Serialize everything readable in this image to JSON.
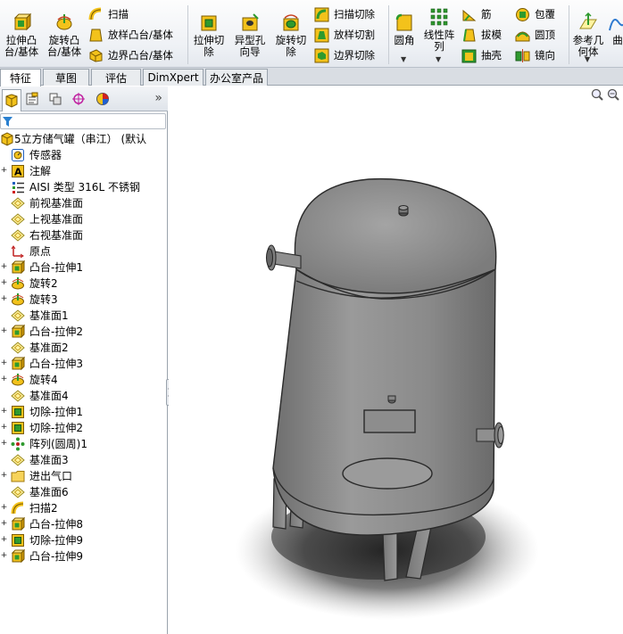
{
  "ribbon": {
    "extrude_boss": "拉伸凸\n台/基体",
    "revolve_boss": "旋转凸\n台/基体",
    "sweep": "扫描",
    "loft_boss": "放样凸台/基体",
    "boundary_boss": "边界凸台/基体",
    "extrude_cut": "拉伸切\n除",
    "hole_wizard": "异型孔\n向导",
    "revolve_cut": "旋转切\n除",
    "sweep_cut": "扫描切除",
    "loft_cut": "放样切割",
    "boundary_cut": "边界切除",
    "fillet": "圆角",
    "linear_pattern": "线性阵\n列",
    "rib": "筋",
    "draft": "拔模",
    "shell": "抽壳",
    "wrap": "包覆",
    "dome": "圆顶",
    "mirror": "镜向",
    "ref_geometry": "参考几\n何体",
    "curves": "曲"
  },
  "tabs": [
    {
      "label": "特征",
      "active": true
    },
    {
      "label": "草图",
      "active": false
    },
    {
      "label": "评估",
      "active": false
    },
    {
      "label": "DimXpert",
      "active": false
    },
    {
      "label": "办公室产品",
      "active": false
    }
  ],
  "panel": {
    "more": "»",
    "tree": [
      {
        "label": "5立方储气罐（串江）  (默认",
        "icon": "part-icon",
        "expand": ""
      },
      {
        "label": "传感器",
        "icon": "sensor-icon",
        "expand": ""
      },
      {
        "label": "注解",
        "icon": "annotation-icon",
        "expand": "+"
      },
      {
        "label": "AISI 类型 316L 不锈钢",
        "icon": "material-icon",
        "expand": ""
      },
      {
        "label": "前视基准面",
        "icon": "plane-icon",
        "expand": ""
      },
      {
        "label": "上视基准面",
        "icon": "plane-icon",
        "expand": ""
      },
      {
        "label": "右视基准面",
        "icon": "plane-icon",
        "expand": ""
      },
      {
        "label": "原点",
        "icon": "origin-icon",
        "expand": ""
      },
      {
        "label": "凸台-拉伸1",
        "icon": "extrude-icon",
        "expand": "+"
      },
      {
        "label": "旋转2",
        "icon": "revolve-icon",
        "expand": "+"
      },
      {
        "label": "旋转3",
        "icon": "revolve-icon",
        "expand": "+"
      },
      {
        "label": "基准面1",
        "icon": "plane-icon",
        "expand": ""
      },
      {
        "label": "凸台-拉伸2",
        "icon": "extrude-icon",
        "expand": "+"
      },
      {
        "label": "基准面2",
        "icon": "plane-icon",
        "expand": ""
      },
      {
        "label": "凸台-拉伸3",
        "icon": "extrude-icon",
        "expand": "+"
      },
      {
        "label": "旋转4",
        "icon": "revolve-icon",
        "expand": "+"
      },
      {
        "label": "基准面4",
        "icon": "plane-icon",
        "expand": ""
      },
      {
        "label": "切除-拉伸1",
        "icon": "cut-icon",
        "expand": "+"
      },
      {
        "label": "切除-拉伸2",
        "icon": "cut-icon",
        "expand": "+"
      },
      {
        "label": "阵列(圆周)1",
        "icon": "pattern-icon",
        "expand": "+"
      },
      {
        "label": "基准面3",
        "icon": "plane-icon",
        "expand": ""
      },
      {
        "label": "进出气口",
        "icon": "folder-icon",
        "expand": "+"
      },
      {
        "label": "基准面6",
        "icon": "plane-icon",
        "expand": ""
      },
      {
        "label": "扫描2",
        "icon": "sweep-icon",
        "expand": "+"
      },
      {
        "label": "凸台-拉伸8",
        "icon": "extrude-icon",
        "expand": "+"
      },
      {
        "label": "切除-拉伸9",
        "icon": "cut-icon",
        "expand": "+"
      },
      {
        "label": "凸台-拉伸9",
        "icon": "extrude-icon",
        "expand": "+"
      }
    ]
  },
  "colors": {
    "tank_body": "#8a8a8a",
    "tank_light": "#a0a0a0",
    "edge": "#2a2a2a",
    "shadow": "#333333",
    "accent_yellow": "#f3c21b",
    "accent_green": "#2e9a2e"
  }
}
